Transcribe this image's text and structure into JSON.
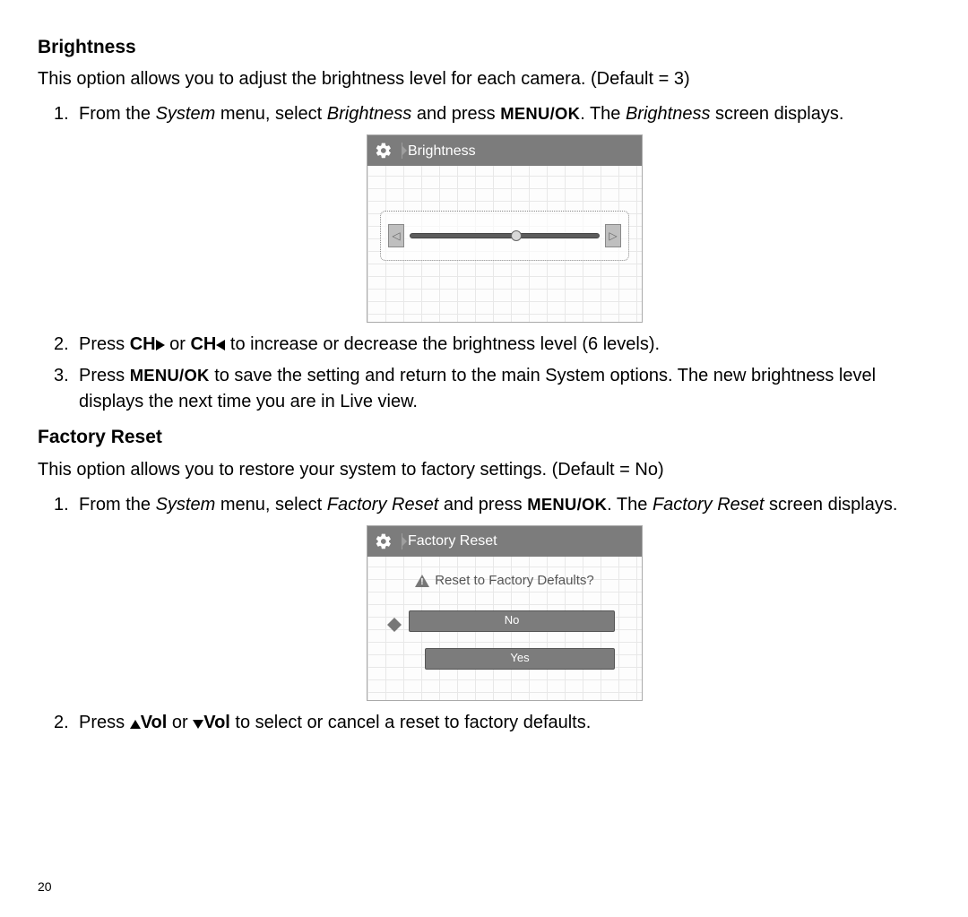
{
  "page_number": "20",
  "brightness": {
    "heading": "Brightness",
    "description": "This option allows you to adjust the brightness level for each camera. (Default = 3)",
    "step1_a": "From the ",
    "step1_b": "System",
    "step1_c": " menu, select ",
    "step1_d": "Brightness",
    "step1_e": " and press ",
    "step1_f": "MENU/OK",
    "step1_g": ". The ",
    "step1_h": "Brightness",
    "step1_i": " screen displays.",
    "ui_title": "Brightness",
    "slider_value_percent": 56,
    "step2_a": "Press ",
    "step2_b": "CH",
    "step2_c": " or ",
    "step2_d": "CH",
    "step2_e": " to increase or decrease the brightness level (6 levels).",
    "step3_a": "Press ",
    "step3_b": "MENU/OK",
    "step3_c": " to save the setting and return to the main System options. The new brightness level displays the next time you are in Live view."
  },
  "factory_reset": {
    "heading": "Factory Reset",
    "description": "This option allows you to restore your system to factory settings. (Default = No)",
    "step1_a": "From the ",
    "step1_b": "System",
    "step1_c": " menu, select ",
    "step1_d": "Factory Reset",
    "step1_e": " and press ",
    "step1_f": "MENU/OK",
    "step1_g": ". The ",
    "step1_h": "Factory Reset",
    "step1_i": " screen displays.",
    "ui_title": "Factory Reset",
    "warn_text": "Reset to Factory Defaults?",
    "option_no": "No",
    "option_yes": "Yes",
    "step2_a": "Press  ",
    "step2_b": "Vol",
    "step2_c": " or ",
    "step2_d": "Vol",
    "step2_e": " to select or cancel a reset to factory defaults."
  }
}
